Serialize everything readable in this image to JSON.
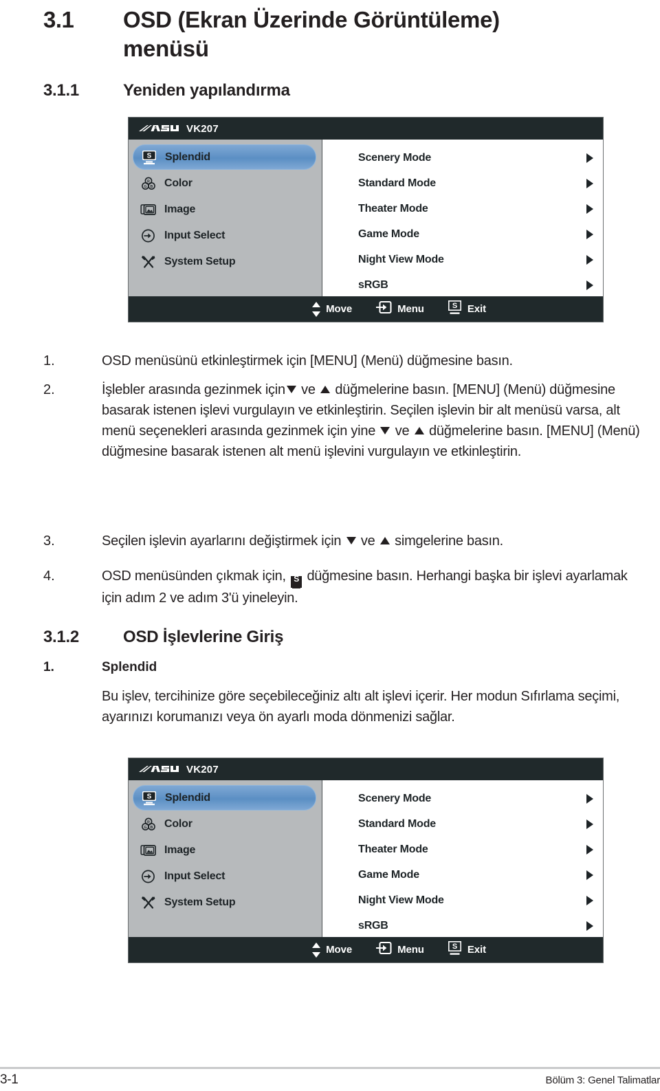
{
  "headings": {
    "h1_number": "3.1",
    "h1_title": "OSD (Ekran Üzerinde Görüntüleme) menüsü",
    "h2_first_number": "3.1.1",
    "h2_first_title": "Yeniden yapılandırma",
    "h2_second_number": "3.1.2",
    "h2_second_title": "OSD İşlevlerine Giriş",
    "h3_number": "1.",
    "h3_title": "Splendid"
  },
  "osd": {
    "brand": "ASUS",
    "model": "VK207",
    "sidebar": [
      {
        "label": "Splendid",
        "icon": "splendid-monitor-icon",
        "active": true
      },
      {
        "label": "Color",
        "icon": "color-rgb-icon",
        "active": false
      },
      {
        "label": "Image",
        "icon": "image-picture-icon",
        "active": false
      },
      {
        "label": "Input Select",
        "icon": "input-arrow-icon",
        "active": false
      },
      {
        "label": "System Setup",
        "icon": "system-tools-icon",
        "active": false
      }
    ],
    "items": [
      "Scenery Mode",
      "Standard Mode",
      "Theater Mode",
      "Game Mode",
      "Night View Mode",
      "sRGB"
    ],
    "footer": {
      "move": "Move",
      "menu": "Menu",
      "exit": "Exit",
      "exit_glyph": "S"
    },
    "colors": {
      "titlebar": "#20292b",
      "sidebar": "#b7babc",
      "highlight": "#5b8fc4",
      "panel": "#ffffff"
    }
  },
  "steps": [
    {
      "number": "1.",
      "text": "OSD menüsünü etkinleştirmek için [MENU] (Menü) düğmesine basın."
    },
    {
      "number": "2.",
      "text_a": "İşlebler arasında gezinmek için",
      "text_b": "ve",
      "text_c": "düğmelerine basın. [MENU] (Menü) düğmesine basarak istenen işlevi vurgulayın ve etkinleştirin. Seçilen işlevin bir alt menüsü varsa, alt menü seçenekleri arasında gezinmek için yine",
      "text_d": "ve",
      "text_e": "düğmelerine basın. [MENU] (Menü) düğmesine basarak istenen alt menü işlevini vurgulayın ve etkinleştirin."
    },
    {
      "number": "3.",
      "text_a": "Seçilen işlevin ayarlarını değiştirmek için",
      "text_b": "ve",
      "text_c": "simgelerine basın."
    },
    {
      "number": "4.",
      "text_a": "OSD menüsünden çıkmak için,",
      "text_b": "düğmesine basın. Herhangi başka bir işlevi ayarlamak için adım 2 ve adım 3'ü yineleyin."
    }
  ],
  "splendid_paragraph": "Bu işlev, tercihinize göre seçebileceğiniz altı alt işlevi içerir. Her modun Sıfırlama seçimi, ayarınızı korumanızı veya ön ayarlı moda dönmenizi sağlar.",
  "page_footer": {
    "page_number": "3-1",
    "chapter": "Bölüm 3: Genel Talimatlar"
  }
}
